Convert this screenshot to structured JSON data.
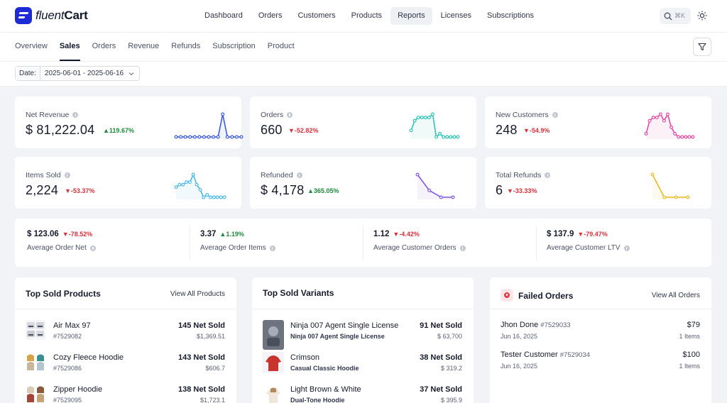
{
  "brand": {
    "name_italic": "fluent",
    "name_bold": "Cart"
  },
  "nav": {
    "items": [
      "Dashboard",
      "Orders",
      "Customers",
      "Products",
      "Reports",
      "Licenses",
      "Subscriptions"
    ],
    "active": "Reports"
  },
  "search": {
    "shortcut": "⌘K",
    "icon": "search-icon"
  },
  "theme": {
    "icon": "sun-icon"
  },
  "subnav": {
    "tabs": [
      "Overview",
      "Sales",
      "Orders",
      "Revenue",
      "Refunds",
      "Subscription",
      "Product"
    ],
    "active": "Sales"
  },
  "filter": {
    "icon": "filter-icon"
  },
  "date": {
    "label": "Date:",
    "value": "2025-06-01 - 2025-06-16"
  },
  "metrics": [
    {
      "title": "Net Revenue",
      "value": "$ 81,222.04",
      "change": "119.67%",
      "trend": "up",
      "color": "#3b5bdb",
      "spark": [
        1,
        1,
        1,
        1,
        1,
        1,
        1,
        1,
        1,
        1,
        10,
        1,
        1,
        1,
        1
      ]
    },
    {
      "title": "Orders",
      "value": "660",
      "change": "-52.82%",
      "trend": "down",
      "color": "#2ec4b6",
      "spark": [
        3,
        6,
        7,
        7,
        7,
        7,
        8,
        1,
        2,
        1,
        1,
        1,
        1,
        1
      ]
    },
    {
      "title": "New Customers",
      "value": "248",
      "change": "-54.9%",
      "trend": "down",
      "color": "#e64ba3",
      "spark": [
        2,
        6,
        7,
        7,
        8,
        6,
        8,
        4,
        2,
        1,
        1,
        1,
        1,
        1
      ]
    },
    {
      "title": "Items Sold",
      "value": "2,224",
      "change": "-53.37%",
      "trend": "down",
      "color": "#4cb8e6",
      "spark": [
        4,
        5,
        5,
        6,
        6,
        9,
        5,
        3,
        0,
        1,
        0,
        0,
        0,
        0,
        0
      ]
    },
    {
      "title": "Refunded",
      "value": "$ 4,178",
      "change": "365.05%",
      "trend": "up",
      "color": "#8257d9",
      "spark": [
        10,
        3,
        0,
        0
      ]
    },
    {
      "title": "Total Refunds",
      "value": "6",
      "change": "-33.33%",
      "trend": "down",
      "color": "#e8b820",
      "spark": [
        10,
        2,
        2,
        2
      ]
    }
  ],
  "summary": [
    {
      "value": "$ 123.06",
      "change": "-78.52%",
      "trend": "down",
      "label": "Average Order Net"
    },
    {
      "value": "3.37",
      "change": "1.19%",
      "trend": "up",
      "label": "Average Order Items"
    },
    {
      "value": "1.12",
      "change": "-4.42%",
      "trend": "down",
      "label": "Average Customer Orders"
    },
    {
      "value": "$ 137.9",
      "change": "-79.47%",
      "trend": "down",
      "label": "Average Customer LTV"
    }
  ],
  "top_products": {
    "title": "Top Sold Products",
    "link": "View All Products",
    "items": [
      {
        "name": "Air Max 97",
        "sku": "#7529082",
        "sold": "145 Net Sold",
        "amount": "$1,369.51"
      },
      {
        "name": "Cozy Fleece Hoodie",
        "sku": "#7529086",
        "sold": "143 Net Sold",
        "amount": "$606.7"
      },
      {
        "name": "Zipper Hoodie",
        "sku": "#7529095",
        "sold": "138 Net Sold",
        "amount": "$1,723.1"
      }
    ]
  },
  "top_variants": {
    "title": "Top Sold Variants",
    "items": [
      {
        "name": "Ninja 007 Agent Single License",
        "sub": "Ninja 007 Agent Single License",
        "sold": "91 Net Sold",
        "amount": "$ 63,700"
      },
      {
        "name": "Crimson",
        "sub": "Casual Classic Hoodie",
        "sold": "38 Net Sold",
        "amount": "$ 319.2"
      },
      {
        "name": "Light Brown & White",
        "sub": "Dual-Tone Hoodie",
        "sold": "37 Net Sold",
        "amount": "$ 395.9"
      }
    ]
  },
  "failed_orders": {
    "title": "Failed Orders",
    "link": "View All Orders",
    "items": [
      {
        "name": "Jhon Done",
        "id": "#7529033",
        "date": "Jun 16, 2025",
        "amount": "$79",
        "qty": "1 Items"
      },
      {
        "name": "Tester Customer",
        "id": "#7529034",
        "date": "Jun 16, 2025",
        "amount": "$100",
        "qty": "1 Items"
      }
    ]
  }
}
